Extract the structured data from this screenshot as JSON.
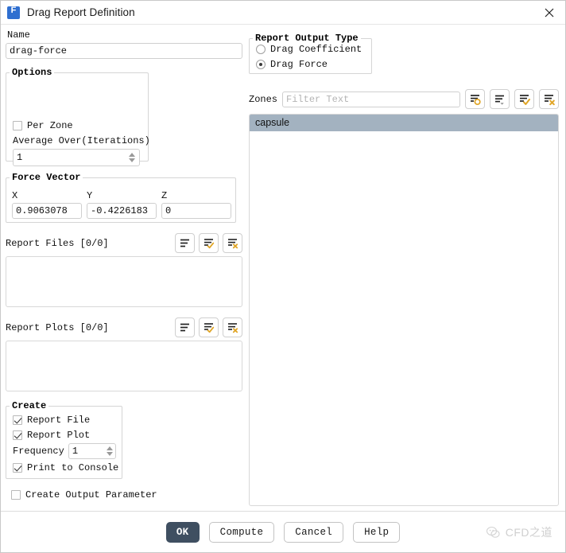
{
  "window": {
    "title": "Drag Report Definition",
    "app_icon": "fluent-f-icon",
    "close_icon": "close-icon"
  },
  "name_section": {
    "label": "Name",
    "value": "drag-force",
    "placeholder": ""
  },
  "options": {
    "title": "Options",
    "per_zone": {
      "label": "Per Zone",
      "checked": false
    },
    "average_over": {
      "label": "Average Over(Iterations)",
      "value": "1"
    }
  },
  "force_vector": {
    "title": "Force Vector",
    "fields": [
      {
        "label": "X",
        "value": "0.9063078"
      },
      {
        "label": "Y",
        "value": "-0.4226183"
      },
      {
        "label": "Z",
        "value": "0"
      }
    ]
  },
  "report_output_type": {
    "title": "Report Output Type",
    "options": [
      {
        "label": "Drag Coefficient",
        "selected": false
      },
      {
        "label": "Drag Force",
        "selected": true
      }
    ]
  },
  "zones": {
    "label": "Zones",
    "filter_placeholder": "Filter Text",
    "filter_value": "",
    "toolbar": [
      {
        "name": "list-new-icon",
        "glyph": "list-circle"
      },
      {
        "name": "list-dropdown-icon",
        "glyph": "list-caret"
      },
      {
        "name": "list-select-all-icon",
        "glyph": "list-check"
      },
      {
        "name": "list-deselect-all-icon",
        "glyph": "list-x"
      }
    ],
    "items": [
      {
        "label": "capsule",
        "selected": true
      }
    ]
  },
  "report_files": {
    "label": "Report Files [0/0]",
    "toolbar": [
      {
        "name": "report-files-new-icon",
        "glyph": "list-plain"
      },
      {
        "name": "report-files-edit-icon",
        "glyph": "list-check"
      },
      {
        "name": "report-files-delete-icon",
        "glyph": "list-x"
      }
    ],
    "items": []
  },
  "report_plots": {
    "label": "Report Plots [0/0]",
    "toolbar": [
      {
        "name": "report-plots-new-icon",
        "glyph": "list-plain"
      },
      {
        "name": "report-plots-edit-icon",
        "glyph": "list-check"
      },
      {
        "name": "report-plots-delete-icon",
        "glyph": "list-x"
      }
    ],
    "items": []
  },
  "create": {
    "title": "Create",
    "report_file": {
      "label": "Report File",
      "checked": true
    },
    "report_plot": {
      "label": "Report Plot",
      "checked": true
    },
    "frequency": {
      "label": "Frequency",
      "value": "1"
    },
    "print_to_console": {
      "label": "Print to Console",
      "checked": true
    },
    "create_output_parameter": {
      "label": "Create Output Parameter",
      "checked": false
    }
  },
  "footer": {
    "ok": "OK",
    "compute": "Compute",
    "cancel": "Cancel",
    "help": "Help",
    "watermark": "CFD之道"
  },
  "colors": {
    "accent_gold": "#e0a526",
    "selection": "#a3b2c0",
    "primary_button": "#3f4f61",
    "app_icon": "#2f6fd0"
  }
}
